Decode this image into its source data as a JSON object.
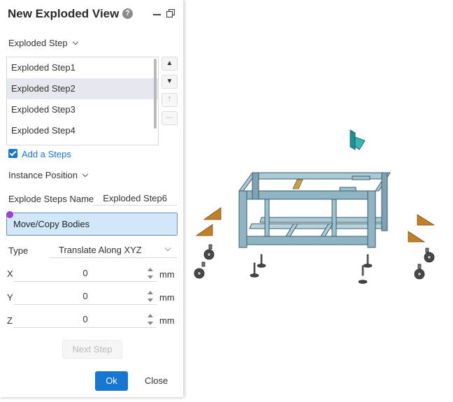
{
  "dialog": {
    "title": "New Exploded View",
    "help_icon": "?",
    "icons": [
      "help-icon",
      "minimize-icon",
      "restore-icon"
    ]
  },
  "exploded_step_section": {
    "label": "Exploded Step",
    "steps": [
      "Exploded Step1",
      "Exploded Step2",
      "Exploded Step3",
      "Exploded Step4"
    ],
    "selected_index": 1,
    "side_buttons": {
      "up": "▲",
      "down": "▼",
      "move_top": "⤒",
      "remove": "—"
    }
  },
  "add_steps": {
    "label": "Add a Steps",
    "checked": true
  },
  "instance_position": {
    "label": "Instance Position"
  },
  "explode_steps_name": {
    "label": "Explode Steps Name",
    "value": "Exploded Step6"
  },
  "selection": {
    "label": "Move/Copy Bodies"
  },
  "type": {
    "label": "Type",
    "value": "Translate Along XYZ"
  },
  "coords": [
    {
      "axis": "X",
      "value": "0",
      "unit": "mm"
    },
    {
      "axis": "Y",
      "value": "0",
      "unit": "mm"
    },
    {
      "axis": "Z",
      "value": "0",
      "unit": "mm"
    }
  ],
  "buttons": {
    "next_step": "Next Step",
    "ok": "Ok",
    "close": "Close"
  },
  "colors": {
    "accent": "#1677d2",
    "frame": "#8fb4c3",
    "bracket": "#c98a2a",
    "teal_part": "#2aa7a8"
  }
}
